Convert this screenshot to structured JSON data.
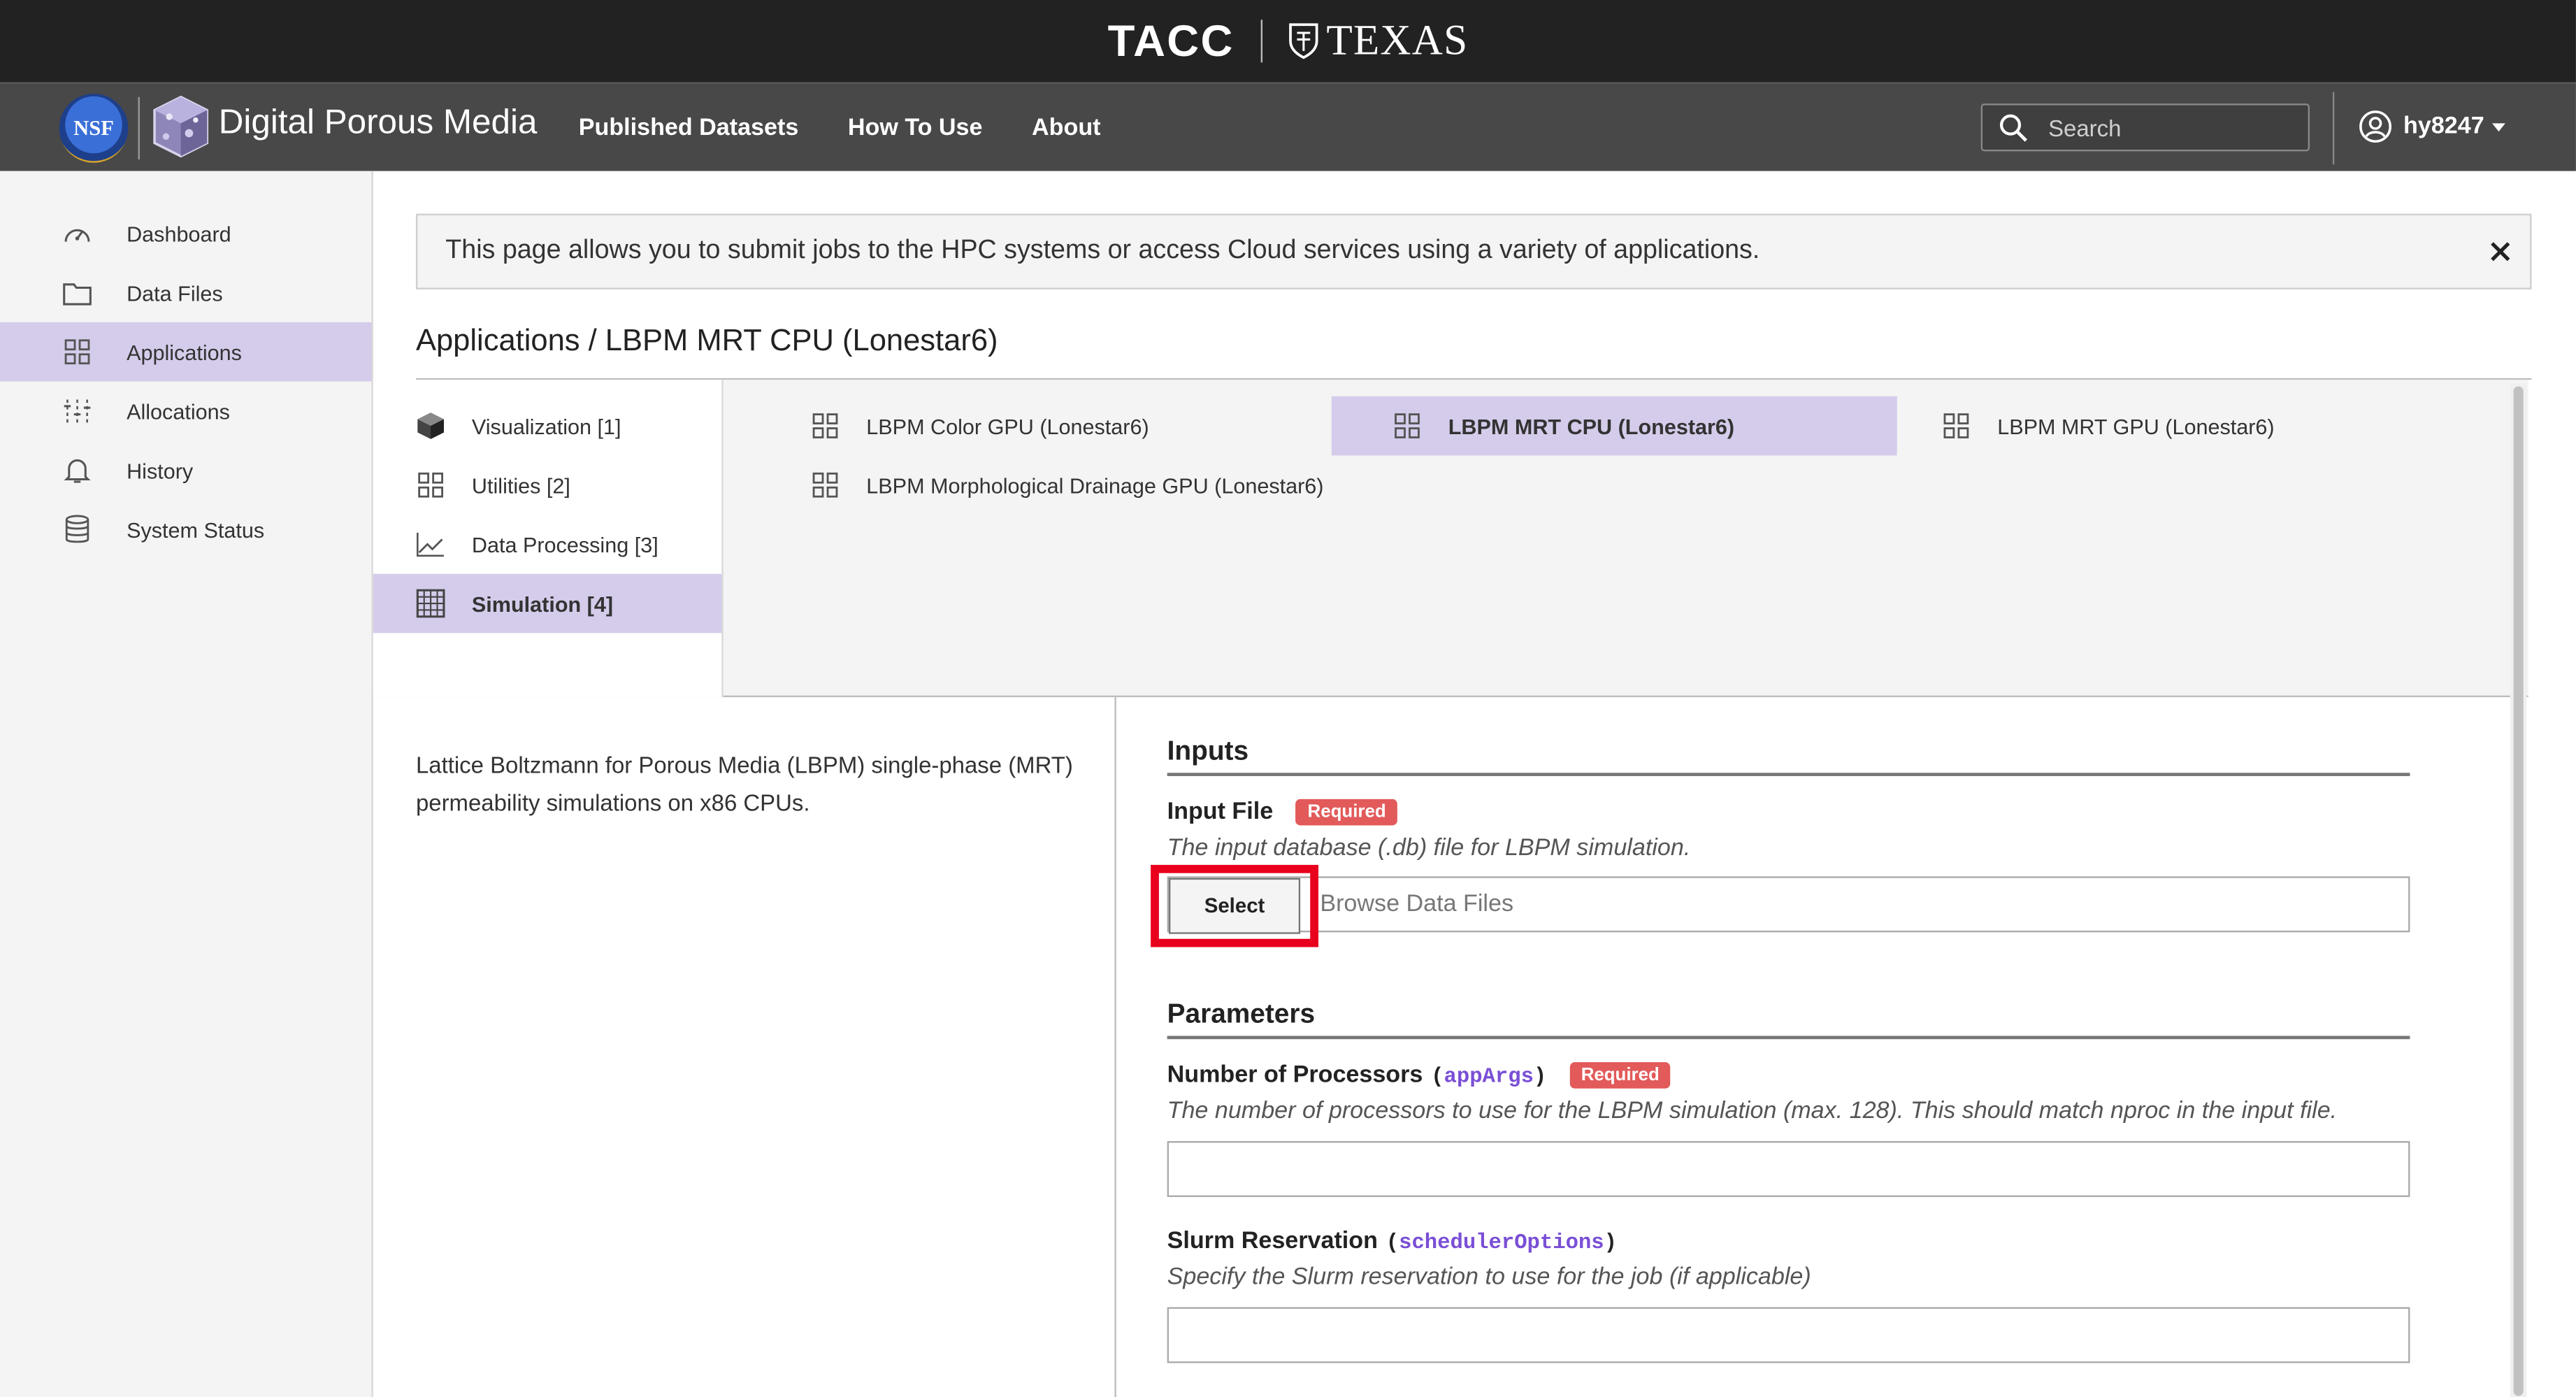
{
  "top_banner": {
    "tacc_logo": "TACC",
    "texas_logo": "TEXAS"
  },
  "header": {
    "nsf_logo": "NSF",
    "brand": "Digital Porous Media",
    "nav": [
      "Published Datasets",
      "How To Use",
      "About"
    ],
    "search_placeholder": "Search",
    "username": "hy8247"
  },
  "sidebar": {
    "items": [
      {
        "label": "Dashboard",
        "icon": "dashboard-gauge-icon",
        "active": false
      },
      {
        "label": "Data Files",
        "icon": "folder-icon",
        "active": false
      },
      {
        "label": "Applications",
        "icon": "grid-icon",
        "active": true
      },
      {
        "label": "Allocations",
        "icon": "sliders-icon",
        "active": false
      },
      {
        "label": "History",
        "icon": "bell-icon",
        "active": false
      },
      {
        "label": "System Status",
        "icon": "database-icon",
        "active": false
      }
    ]
  },
  "alert": {
    "message": "This page allows you to submit jobs to the HPC systems or access Cloud services using a variety of applications."
  },
  "breadcrumb": "Applications / LBPM MRT CPU (Lonestar6)",
  "categories": [
    {
      "label": "Visualization [1]",
      "icon": "cube-icon",
      "active": false
    },
    {
      "label": "Utilities [2]",
      "icon": "grid-icon",
      "active": false
    },
    {
      "label": "Data Processing [3]",
      "icon": "line-chart-icon",
      "active": false
    },
    {
      "label": "Simulation [4]",
      "icon": "simulation-icon",
      "active": true
    }
  ],
  "apps": [
    {
      "label": "LBPM Color GPU (Lonestar6)",
      "active": false
    },
    {
      "label": "LBPM MRT CPU (Lonestar6)",
      "active": true
    },
    {
      "label": "LBPM MRT GPU (Lonestar6)",
      "active": false
    },
    {
      "label": "LBPM Morphological Drainage GPU (Lonestar6)",
      "active": false
    }
  ],
  "description": "Lattice Boltzmann for Porous Media (LBPM) single-phase (MRT) permeability simulations on x86 CPUs.",
  "form": {
    "inputs_title": "Inputs",
    "input_file": {
      "label": "Input File",
      "required": "Required",
      "help": "The input database (.db) file for LBPM simulation.",
      "button": "Select",
      "placeholder": "Browse Data Files"
    },
    "parameters_title": "Parameters",
    "processors": {
      "label": "Number of Processors",
      "code": "appArgs",
      "required": "Required",
      "help": "The number of processors to use for the LBPM simulation (max. 128). This should match nproc in the input file.",
      "value": ""
    },
    "slurm": {
      "label": "Slurm Reservation",
      "code": "schedulerOptions",
      "help": "Specify the Slurm reservation to use for the job (if applicable)",
      "value": ""
    }
  },
  "colors": {
    "accent": "#d5cceb",
    "header": "#484848",
    "banner": "#222222",
    "required_badge": "#e25a5a",
    "highlight": "#e8001c",
    "code": "#7a4fd6"
  }
}
